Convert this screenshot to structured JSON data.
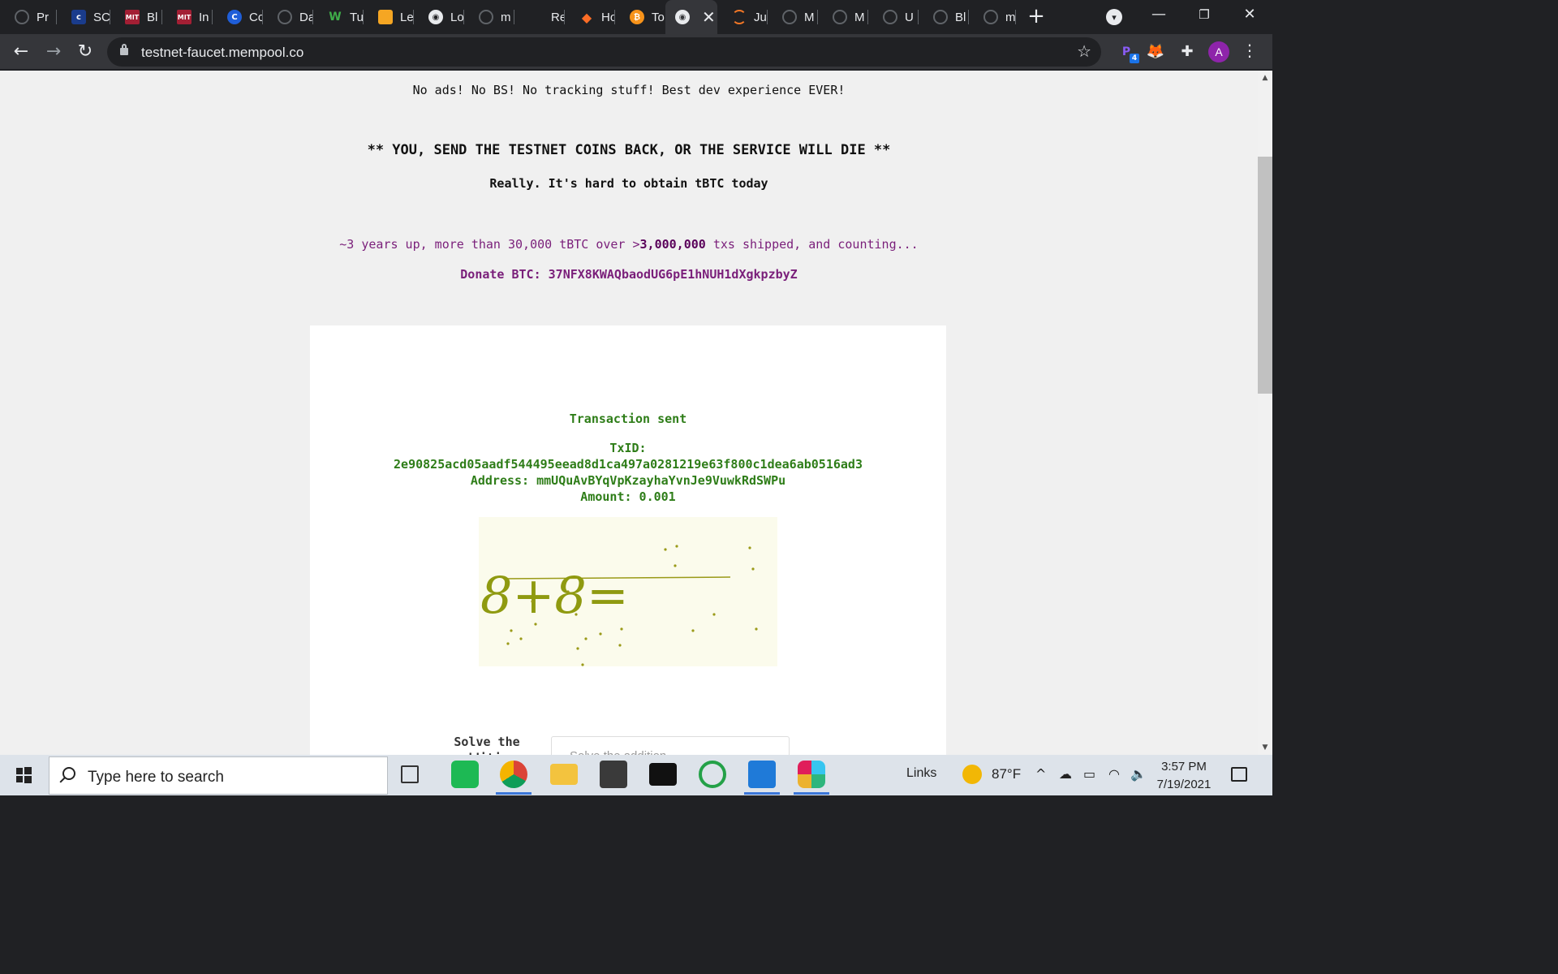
{
  "browser": {
    "tabs": [
      {
        "label": "Pr",
        "favicon": "github-icon"
      },
      {
        "label": "SC",
        "favicon": "sc-icon"
      },
      {
        "label": "Bl",
        "favicon": "mit-ocw-icon"
      },
      {
        "label": "In",
        "favicon": "mit-ocw-icon"
      },
      {
        "label": "Cc",
        "favicon": "coursera-icon"
      },
      {
        "label": "Da",
        "favicon": "github-icon"
      },
      {
        "label": "Tu",
        "favicon": "w3-icon"
      },
      {
        "label": "Le",
        "favicon": "box-icon"
      },
      {
        "label": "Lo",
        "favicon": "globe-icon"
      },
      {
        "label": "m",
        "favicon": "github-icon"
      },
      {
        "label": "Re",
        "favicon": "blank"
      },
      {
        "label": "Ho",
        "favicon": "gitlab-icon"
      },
      {
        "label": "To",
        "favicon": "bitcoin-icon"
      },
      {
        "label": "",
        "favicon": "globe-icon",
        "active": true
      },
      {
        "label": "Ju",
        "favicon": "jupyter-icon"
      },
      {
        "label": "M",
        "favicon": "github-icon"
      },
      {
        "label": "M",
        "favicon": "github-icon"
      },
      {
        "label": "U",
        "favicon": "github-icon"
      },
      {
        "label": "Bl",
        "favicon": "github-icon"
      },
      {
        "label": "m",
        "favicon": "github-icon"
      }
    ],
    "url": "testnet-faucet.mempool.co",
    "extension_badge": "4",
    "avatar_letter": "A"
  },
  "page": {
    "tagline": "No ads! No BS! No tracking stuff! Best dev experience EVER!",
    "warning": "** YOU, SEND THE TESTNET COINS BACK, OR THE SERVICE WILL DIE **",
    "warning_sub": "Really. It's hard to obtain tBTC today",
    "stats_pre": "~3 years up, more than 30,000 tBTC over >",
    "stats_bold": "3,000,000",
    "stats_post": " txs shipped, and counting...",
    "donate": "Donate BTC: 37NFX8KWAQbaodUG6pE1hNUH1dXgkpzbyZ",
    "result": {
      "status": "Transaction sent",
      "txid_label": "TxID:",
      "txid": "2e90825acd05aadf544495eead8d1ca497a0281219e63f800c1dea6ab0516ad3",
      "address": "Address: mmUQuAvBYqVpKzayhaYvnJe9VuwkRdSWPu",
      "amount": "Amount: 0.001"
    },
    "captcha_text": "8+8=",
    "solve_label": "Solve the addition",
    "solve_placeholder": "Solve the addition"
  },
  "taskbar": {
    "search_placeholder": "Type here to search",
    "links_label": "Links",
    "weather": "87°F",
    "time": "3:57 PM",
    "date": "7/19/2021"
  },
  "colors": {
    "success_green": "#2e7d18",
    "donate_purple": "#7a1f7a",
    "page_bg": "#f0f0f0"
  }
}
